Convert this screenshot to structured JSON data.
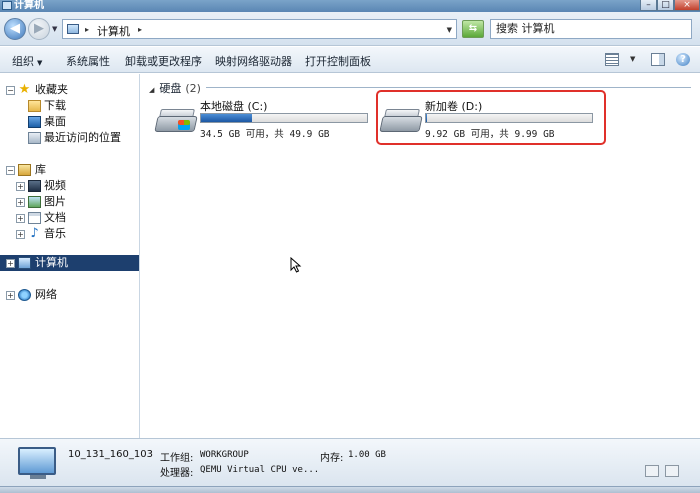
{
  "window": {
    "title": "计算机",
    "buttons": {
      "minimize": "–",
      "maximize": "□",
      "close": "×"
    }
  },
  "address": {
    "crumb": "计算机",
    "separator": "▸",
    "search_placeholder": "搜索 计算机"
  },
  "toolbar": {
    "items": [
      "组织",
      "系统属性",
      "卸载或更改程序",
      "映射网络驱动器",
      "打开控制面板"
    ]
  },
  "nav": {
    "favorites": {
      "label": "收藏夹",
      "children": [
        "下载",
        "桌面",
        "最近访问的位置"
      ]
    },
    "libraries": {
      "label": "库",
      "children": [
        "视频",
        "图片",
        "文档",
        "音乐"
      ]
    },
    "computer": {
      "label": "计算机"
    },
    "network": {
      "label": "网络"
    }
  },
  "content": {
    "group_label": "硬盘",
    "group_count": "(2)",
    "drives": [
      {
        "name": "本地磁盘 (C:)",
        "space_text": "34.5 GB 可用，共 49.9 GB",
        "used_fraction": 0.31
      },
      {
        "name": "新加卷 (D:)",
        "space_text": "9.92 GB 可用，共 9.99 GB",
        "used_fraction": 0.007
      }
    ]
  },
  "details": {
    "computer_name": "10_131_160_103",
    "workgroup_label": "工作组:",
    "workgroup_value": "WORKGROUP",
    "memory_label": "内存:",
    "memory_value": "1.00 GB",
    "processor_label": "处理器:",
    "processor_value": "QEMU Virtual CPU ve..."
  },
  "colors": {
    "selection": "#1d3f6e",
    "highlight_box": "#e0302a",
    "drive_bar": "#1c57a3"
  }
}
